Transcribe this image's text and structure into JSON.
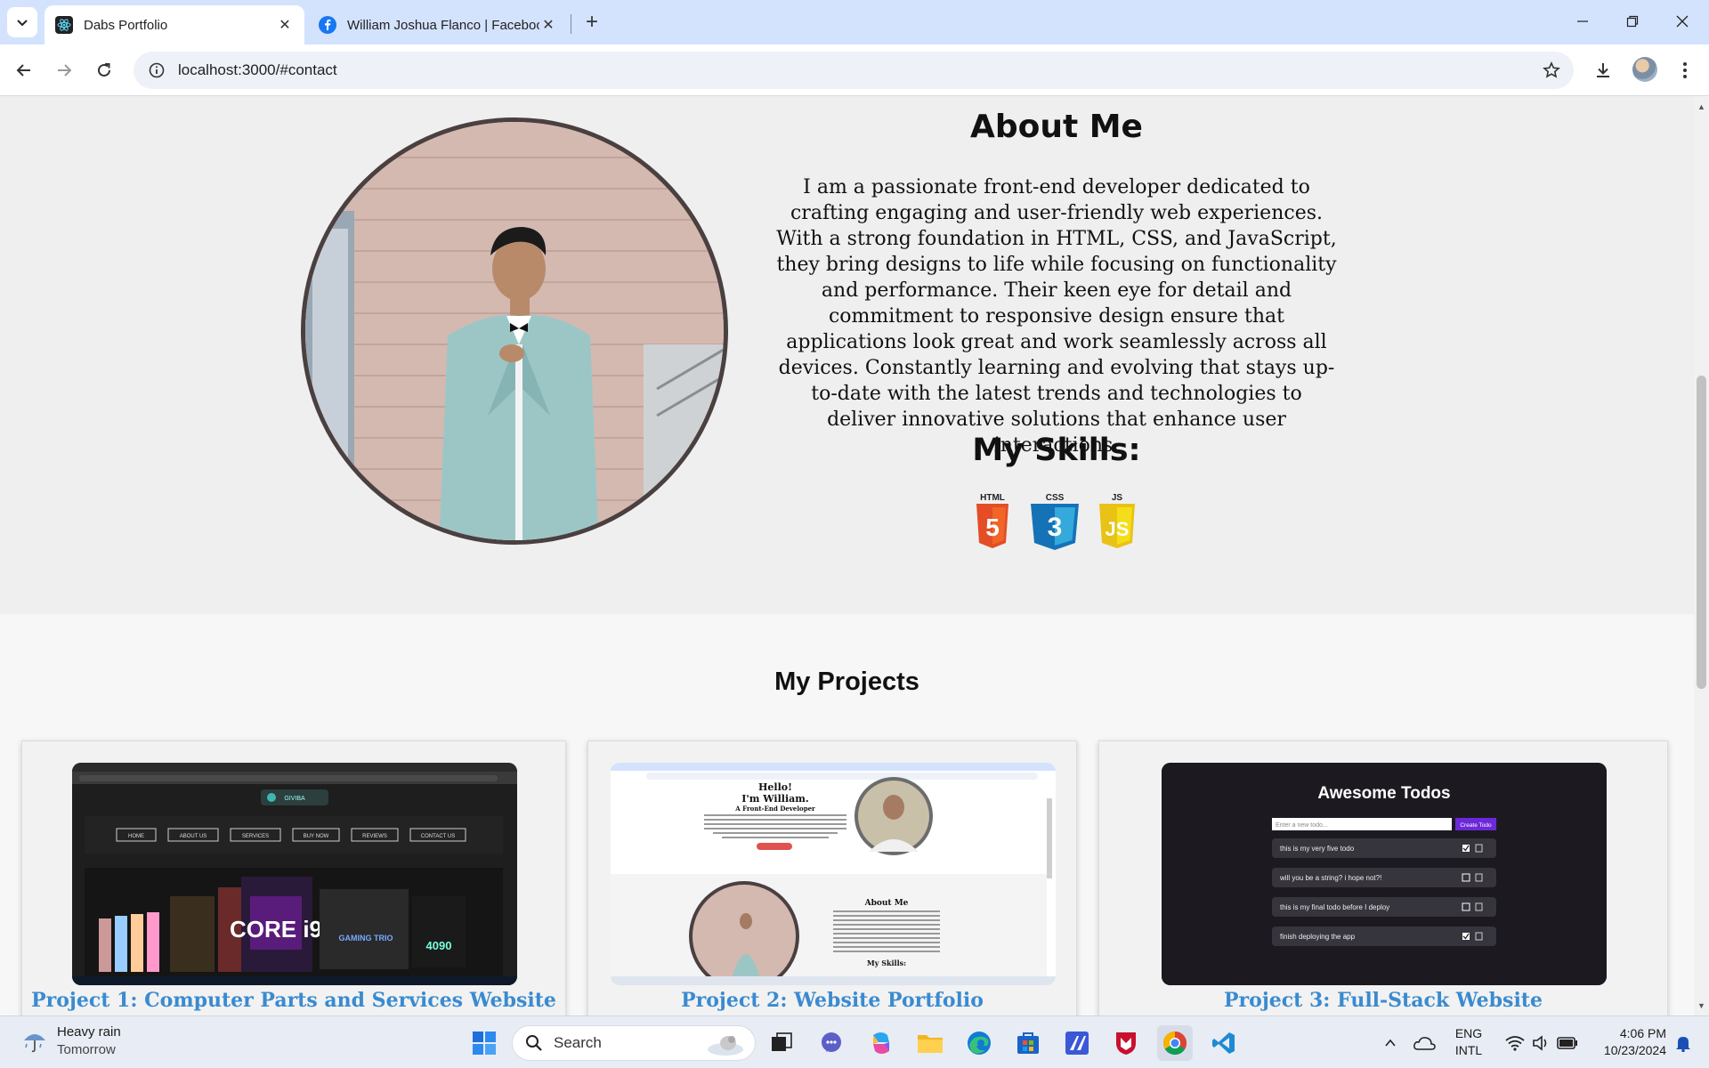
{
  "browser": {
    "tabs": [
      {
        "title": "Dabs Portfolio",
        "active": true
      },
      {
        "title": "William Joshua Flanco | Facebook",
        "active": false
      }
    ],
    "address": "localhost:3000/#contact"
  },
  "about": {
    "title": "About Me",
    "paragraph": "I am a passionate front-end developer dedicated to crafting engaging and user-friendly web experiences. With a strong foundation in HTML, CSS, and JavaScript, they bring designs to life while focusing on functionality and performance. Their keen eye for detail and commitment to responsive design ensure that applications look great and work seamlessly across all devices. Constantly learning and evolving that stays up-to-date with the latest trends and technologies to deliver innovative solutions that enhance user interactions.",
    "skills_title": "My Skills:",
    "skills": [
      {
        "label": "HTML",
        "digit": "5",
        "color": "#e44d26",
        "icon": "html5-icon"
      },
      {
        "label": "CSS",
        "digit": "3",
        "color": "#2965f1",
        "icon": "css3-icon"
      },
      {
        "label": "JS",
        "digit": "JS",
        "color": "#f0db4f",
        "icon": "javascript-icon"
      }
    ]
  },
  "projects": {
    "title": "My Projects",
    "items": [
      {
        "caption": "Project 1: Computer Parts and Services Website",
        "nav": [
          "HOME",
          "ABOUT US",
          "SERVICES",
          "BUY NOW",
          "REVIEWS",
          "CONTACT US"
        ],
        "brand": "GIVIBA",
        "badge": "CORE i9",
        "gpu": "GAMING TRIO",
        "gpu_model": "4090"
      },
      {
        "caption": "Project 2: Website Portfolio",
        "hello": "Hello!",
        "name_line": "I'm William.",
        "role": "A Front-End Developer",
        "about_mini": "About Me",
        "skills_mini": "My Skills:"
      },
      {
        "caption": "Project 3: Full-Stack Website",
        "app_title": "Awesome Todos",
        "input_placeholder": "Enter a new todo...",
        "create_label": "Create Todo",
        "todos": [
          {
            "text": "this is my very five todo",
            "done": true
          },
          {
            "text": "will you be a string? i hope not?!",
            "done": false
          },
          {
            "text": "this is my final todo before I deploy",
            "done": false
          },
          {
            "text": "finish deploying the app",
            "done": true
          }
        ]
      }
    ]
  },
  "taskbar": {
    "weather_title": "Heavy rain",
    "weather_sub": "Tomorrow",
    "search_label": "Search",
    "lang1": "ENG",
    "lang2": "INTL",
    "time": "4:06 PM",
    "date": "10/23/2024"
  }
}
